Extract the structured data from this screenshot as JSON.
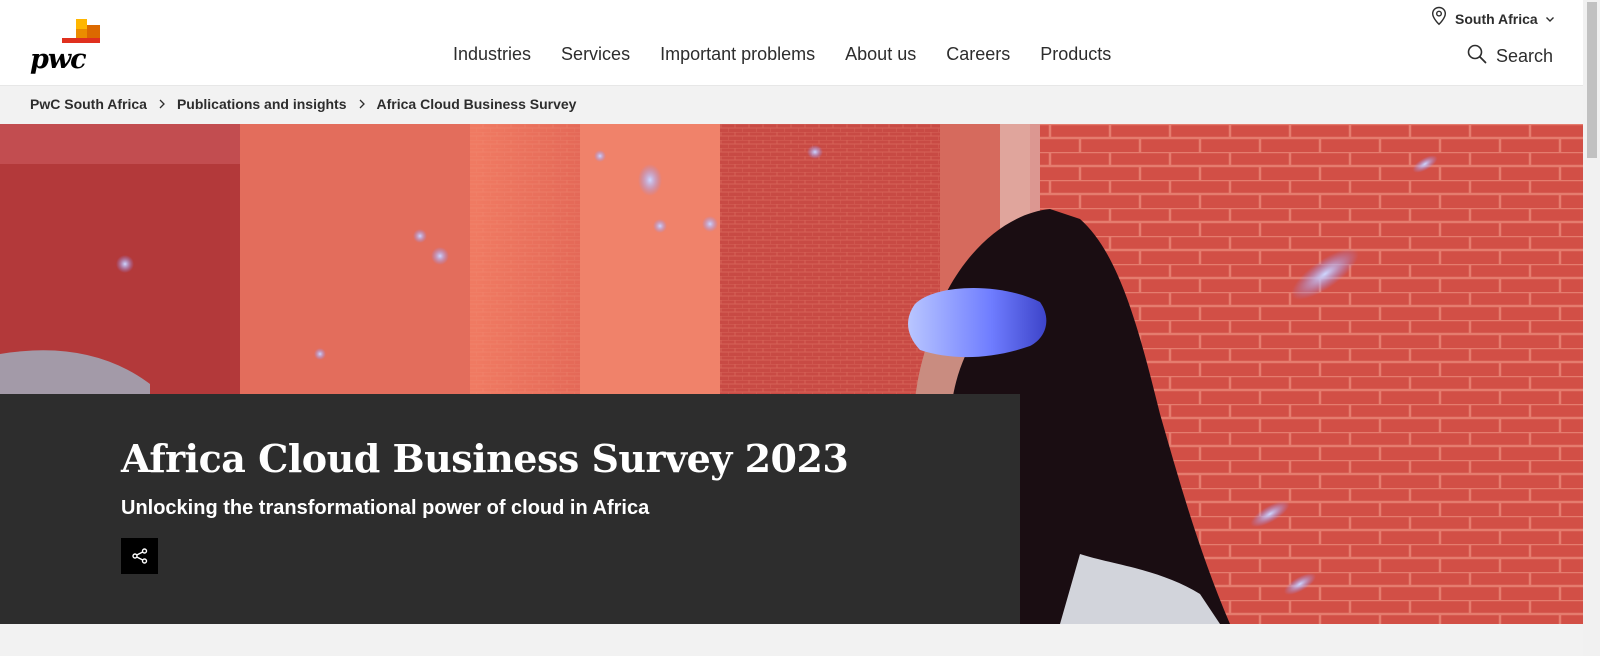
{
  "header": {
    "logo_text": "pwc",
    "nav": [
      {
        "label": "Industries"
      },
      {
        "label": "Services"
      },
      {
        "label": "Important problems"
      },
      {
        "label": "About us"
      },
      {
        "label": "Careers"
      },
      {
        "label": "Products"
      }
    ],
    "region_label": "South Africa",
    "search_label": "Search"
  },
  "breadcrumb": [
    {
      "label": "PwC South Africa"
    },
    {
      "label": "Publications and insights"
    },
    {
      "label": "Africa Cloud Business Survey"
    }
  ],
  "hero": {
    "title": "Africa Cloud Business Survey 2023",
    "subtitle": "Unlocking the transformational power of cloud in Africa",
    "share_icon": "share-icon"
  },
  "colors": {
    "card_background": "#2d2d2d",
    "logo_orange": "#e0301e",
    "logo_amber": "#eb8c00",
    "logo_rose": "#d04a02"
  }
}
